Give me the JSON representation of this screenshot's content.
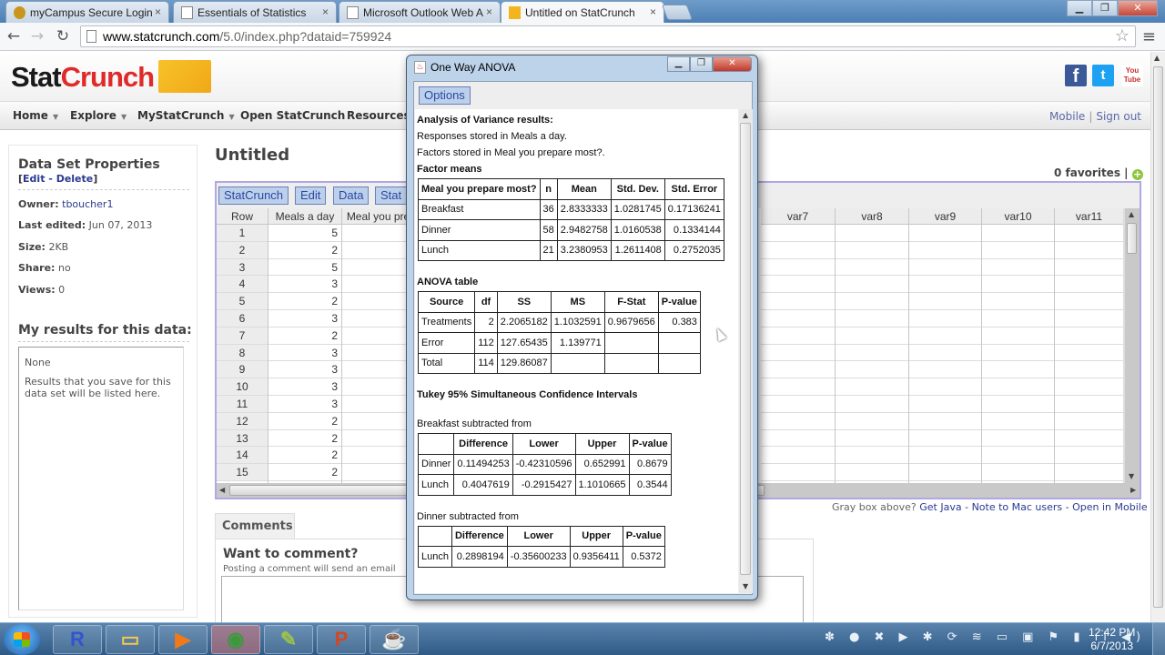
{
  "browser": {
    "tabs": [
      {
        "title": "myCampus Secure Login",
        "icon": "campus-icon"
      },
      {
        "title": "Essentials of Statistics",
        "icon": "page-icon"
      },
      {
        "title": "Microsoft Outlook Web A",
        "icon": "page-icon"
      },
      {
        "title": "Untitled on StatCrunch",
        "icon": "statcrunch-icon",
        "active": true
      }
    ],
    "url_host": "www.statcrunch.com",
    "url_path": "/5.0/index.php?dataid=759924",
    "tab_close": "×",
    "window_buttons": {
      "minimize": "▁",
      "restore": "❐",
      "close": "✕"
    }
  },
  "site": {
    "logo_stat": "Stat",
    "logo_crunch": "Crunch",
    "social": {
      "facebook": "f",
      "twitter": "t",
      "youtube": "You Tube"
    },
    "nav": [
      {
        "label": "Home",
        "caret": true
      },
      {
        "label": "Explore",
        "caret": true
      },
      {
        "label": "MyStatCrunch",
        "caret": true
      },
      {
        "label": "Open StatCrunch",
        "caret": false
      },
      {
        "label": "Resources",
        "caret": false
      }
    ],
    "nav_right": {
      "mobile": "Mobile",
      "sep": "|",
      "signout": "Sign out"
    }
  },
  "sidebar": {
    "title": "Data Set Properties",
    "links_open": "[",
    "edit": "Edit",
    "dash": " - ",
    "delete": "Delete",
    "links_close": "]",
    "props": [
      {
        "label": "Owner:",
        "value": "tboucher1",
        "link": true
      },
      {
        "label": "Last edited:",
        "value": "Jun 07, 2013"
      },
      {
        "label": "Size:",
        "value": "2KB"
      },
      {
        "label": "Share:",
        "value": "no"
      },
      {
        "label": "Views:",
        "value": "0"
      }
    ],
    "results_title": "My results for this data:",
    "results_none": "None",
    "results_note": "Results that you save for this data set will be listed here."
  },
  "main": {
    "title": "Untitled",
    "favorites": "0 favorites",
    "fav_sep": "|",
    "fav_add": "+",
    "applet_menu": [
      "StatCrunch",
      "Edit",
      "Data",
      "Stat"
    ],
    "columns_left": [
      "Row",
      "Meals a day",
      "Meal you pre"
    ],
    "columns_right": [
      "var7",
      "var8",
      "var9",
      "var10",
      "var11"
    ],
    "rows": [
      {
        "row": "1",
        "meals": "5"
      },
      {
        "row": "2",
        "meals": "2"
      },
      {
        "row": "3",
        "meals": "5"
      },
      {
        "row": "4",
        "meals": "3"
      },
      {
        "row": "5",
        "meals": "2"
      },
      {
        "row": "6",
        "meals": "3"
      },
      {
        "row": "7",
        "meals": "2"
      },
      {
        "row": "8",
        "meals": "3"
      },
      {
        "row": "9",
        "meals": "3"
      },
      {
        "row": "10",
        "meals": "3"
      },
      {
        "row": "11",
        "meals": "3"
      },
      {
        "row": "12",
        "meals": "2"
      },
      {
        "row": "13",
        "meals": "2"
      },
      {
        "row": "14",
        "meals": "2"
      },
      {
        "row": "15",
        "meals": "2"
      }
    ],
    "java_note": {
      "prefix": "Gray box above? ",
      "get_java": "Get Java",
      "sep": " - ",
      "mac": "Note to Mac users",
      "mobile": "Open in Mobile"
    },
    "comments_tab": "Comments",
    "want_comment": "Want to comment?",
    "posting_note": "Posting a comment will send an email"
  },
  "dialog": {
    "title": "One Way ANOVA",
    "options": "Options",
    "heading": "Analysis of Variance results:",
    "responses": "Responses stored in Meals a day.",
    "factors": "Factors stored in Meal you prepare most?.",
    "factor_means_title": "Factor means",
    "factor_means": {
      "headers": [
        "Meal you prepare most?",
        "n",
        "Mean",
        "Std. Dev.",
        "Std. Error"
      ],
      "rows": [
        [
          "Breakfast",
          "36",
          "2.8333333",
          "1.0281745",
          "0.17136241"
        ],
        [
          "Dinner",
          "58",
          "2.9482758",
          "1.0160538",
          "0.1334144"
        ],
        [
          "Lunch",
          "21",
          "3.2380953",
          "1.2611408",
          "0.2752035"
        ]
      ]
    },
    "anova_title": "ANOVA table",
    "anova": {
      "headers": [
        "Source",
        "df",
        "SS",
        "MS",
        "F-Stat",
        "P-value"
      ],
      "rows": [
        [
          "Treatments",
          "2",
          "2.2065182",
          "1.1032591",
          "0.9679656",
          "0.383"
        ],
        [
          "Error",
          "112",
          "127.65435",
          "1.139771",
          "",
          ""
        ],
        [
          "Total",
          "114",
          "129.86087",
          "",
          "",
          ""
        ]
      ]
    },
    "tukey_title": "Tukey 95% Simultaneous Confidence Intervals",
    "tukey_breakfast_title": "Breakfast subtracted from",
    "tukey_breakfast": {
      "headers": [
        "",
        "Difference",
        "Lower",
        "Upper",
        "P-value"
      ],
      "rows": [
        [
          "Dinner",
          "0.11494253",
          "-0.42310596",
          "0.652991",
          "0.8679"
        ],
        [
          "Lunch",
          "0.4047619",
          "-0.2915427",
          "1.1010665",
          "0.3544"
        ]
      ]
    },
    "tukey_dinner_title": "Dinner subtracted from",
    "tukey_dinner": {
      "headers": [
        "",
        "Difference",
        "Lower",
        "Upper",
        "P-value"
      ],
      "rows": [
        [
          "Lunch",
          "0.2898194",
          "-0.35600233",
          "0.9356411",
          "0.5372"
        ]
      ]
    }
  },
  "taskbar": {
    "apps": [
      {
        "name": "r",
        "glyph": "R",
        "color": "#3355cc"
      },
      {
        "name": "file-explorer",
        "glyph": "▭",
        "color": "#f2c84b"
      },
      {
        "name": "media-player",
        "glyph": "▶",
        "color": "#f07a1a"
      },
      {
        "name": "chrome",
        "glyph": "◉",
        "color": "#3a9a3a",
        "active": true
      },
      {
        "name": "notepad-plus-plus",
        "glyph": "✎",
        "color": "#9bc34a"
      },
      {
        "name": "powerpoint",
        "glyph": "P",
        "color": "#d24726"
      },
      {
        "name": "java",
        "glyph": "☕",
        "color": "#c33"
      }
    ],
    "tray": "✽ ● ✖ ▶ ✱ ⟳ ≋ ▭ ▣ ⚑ ▮ ıl ◀)",
    "time": "12:42 PM",
    "date": "6/7/2013"
  }
}
